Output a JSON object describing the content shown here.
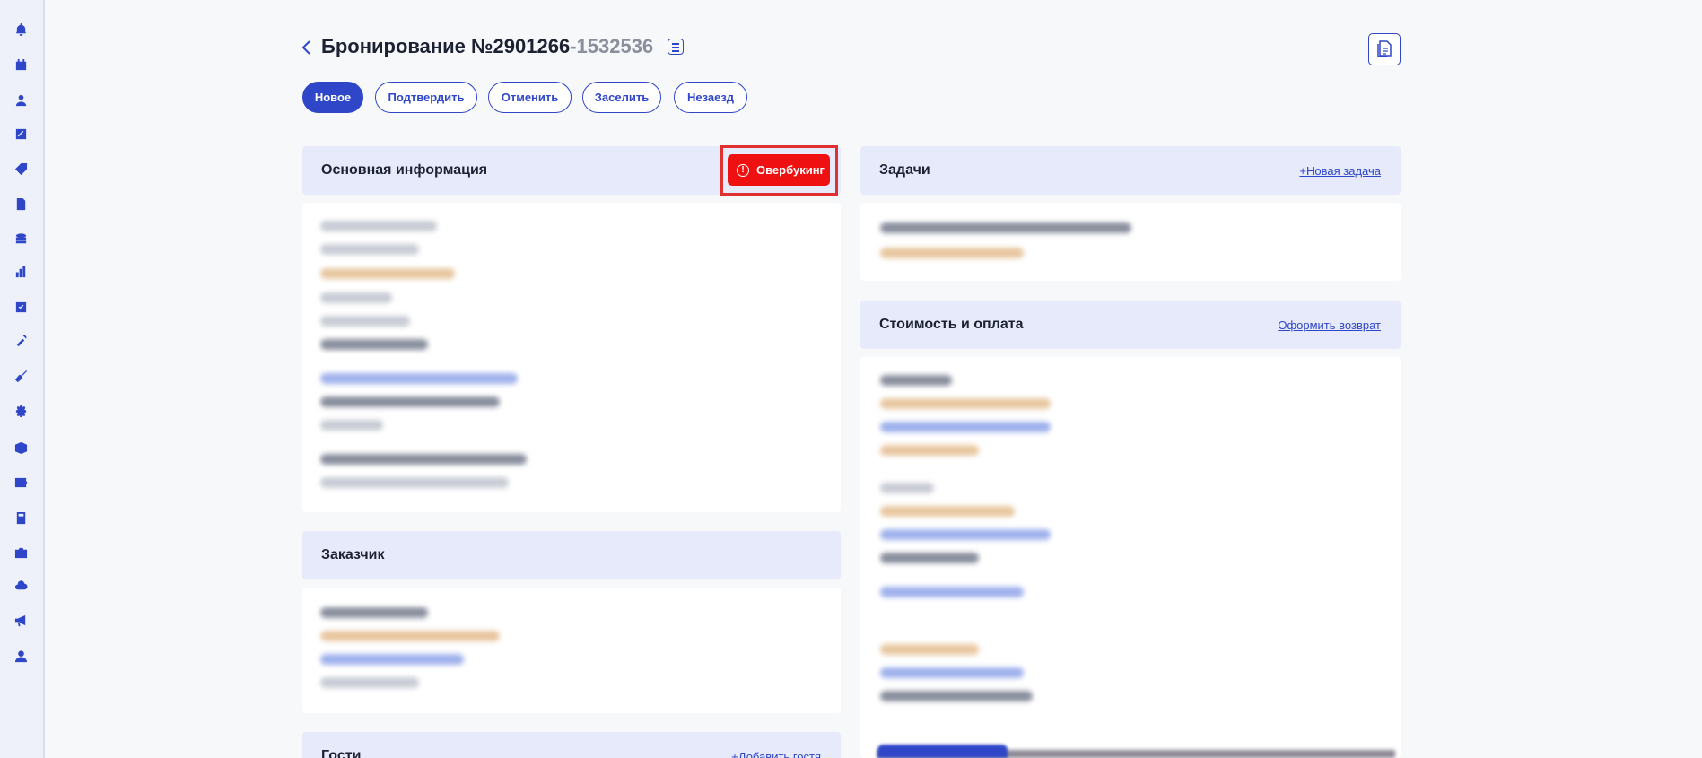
{
  "header": {
    "title": "Бронирование №2901266",
    "subtitle": "-1532536"
  },
  "tabs": [
    {
      "label": "Новое",
      "active": true
    },
    {
      "label": "Подтвердить",
      "active": false
    },
    {
      "label": "Отменить",
      "active": false
    },
    {
      "label": "Заселить",
      "active": false
    },
    {
      "label": "Незаезд",
      "active": false
    }
  ],
  "cards": {
    "main_info": {
      "title": "Основная информация",
      "badge": "Овербукинг"
    },
    "customer": {
      "title": "Заказчик"
    },
    "guests": {
      "title": "Гости",
      "link": "+Добавить гостя"
    },
    "tasks": {
      "title": "Задачи",
      "link": "+Новая задача"
    },
    "payment": {
      "title": "Стоимость и оплата",
      "link": "Оформить возврат"
    }
  },
  "sidebar": {
    "icons": [
      "bell-icon",
      "calendar-icon",
      "user-icon",
      "percent-icon",
      "tag-icon",
      "document-icon",
      "coins-icon",
      "chart-icon",
      "check-icon",
      "tools-icon",
      "broom-icon",
      "gear-icon",
      "box-icon",
      "wallet-icon",
      "calculator-icon",
      "camera-icon",
      "cloud-icon",
      "megaphone-icon",
      "profile-icon"
    ]
  },
  "colors": {
    "accent": "#2f46c8",
    "badge_red": "#ef1111",
    "card_header": "#e6eafb"
  }
}
